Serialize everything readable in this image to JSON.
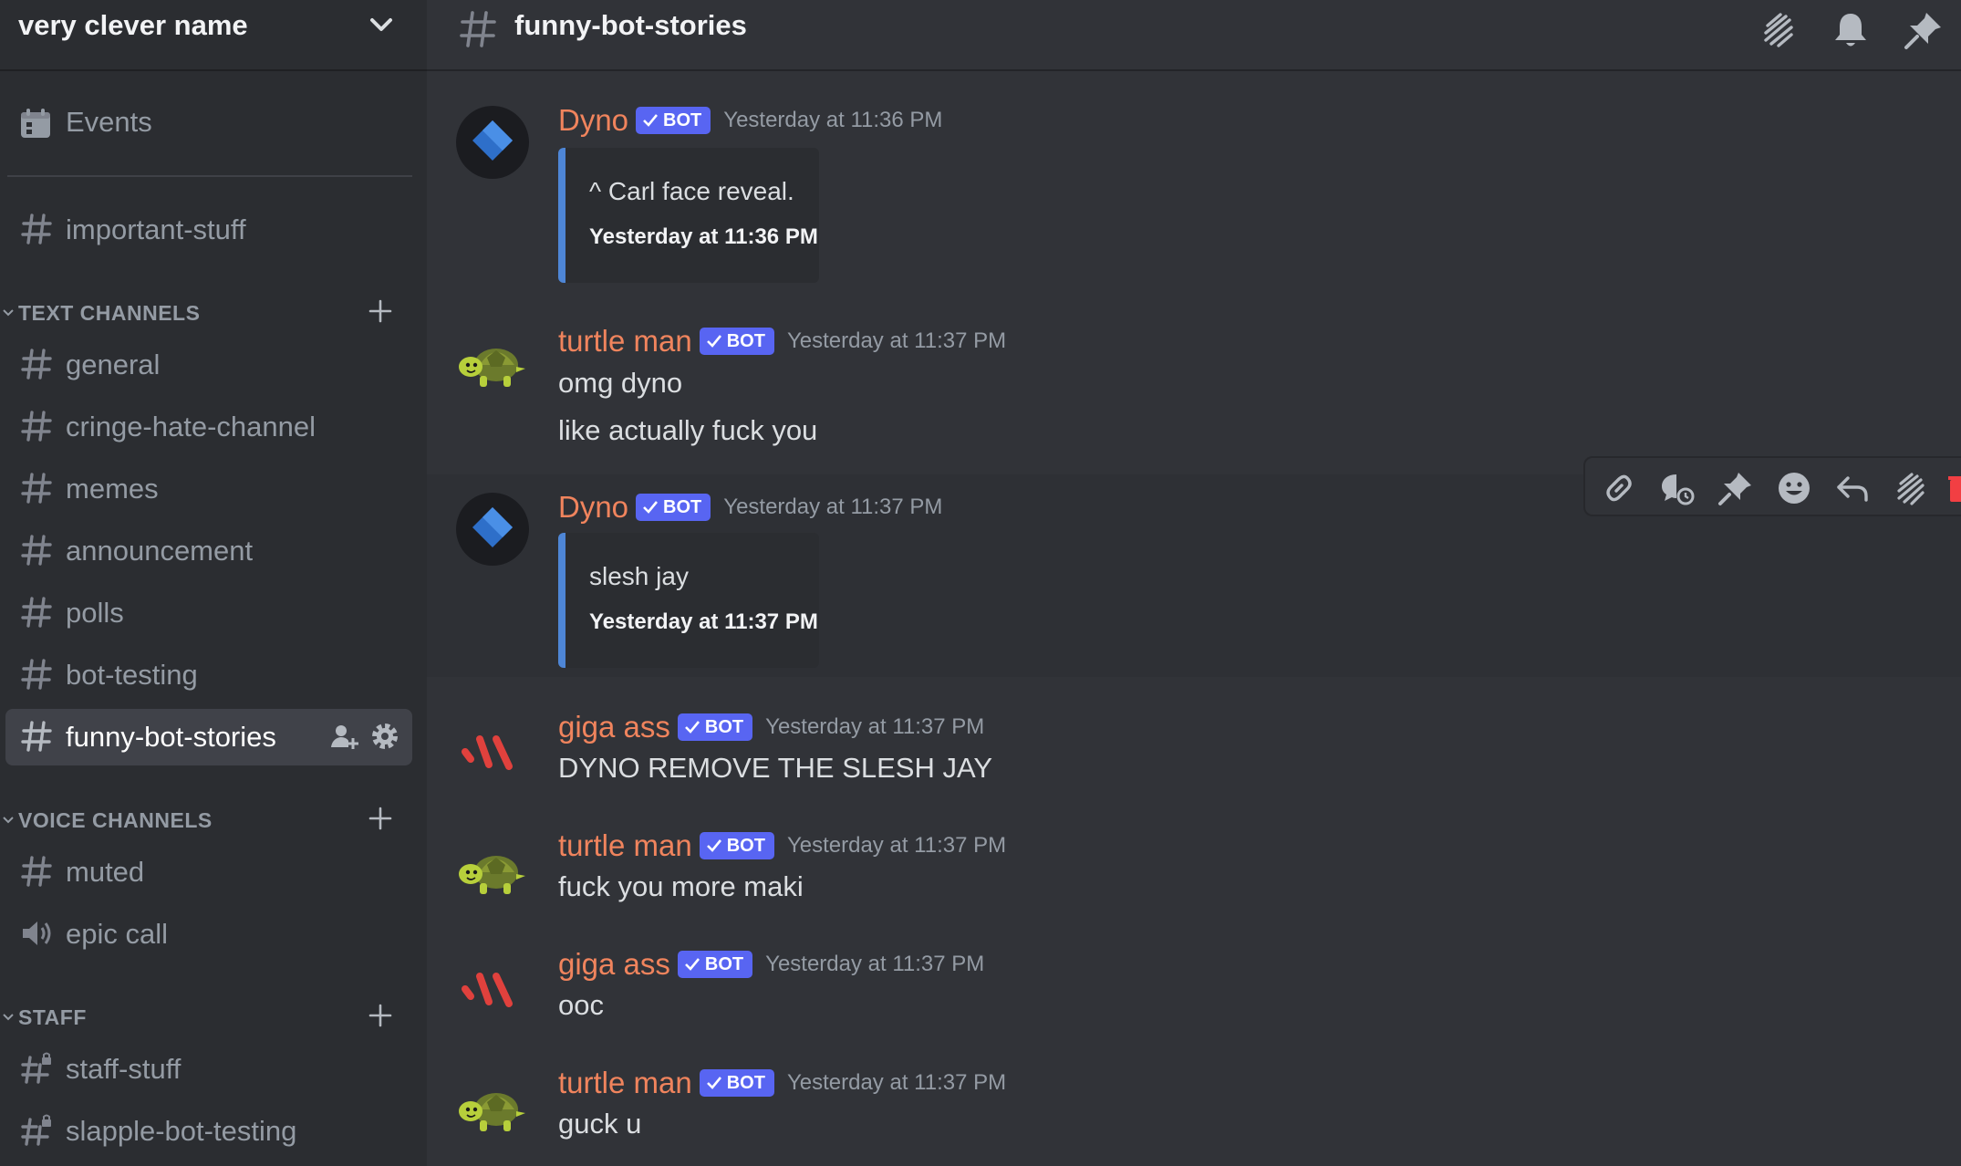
{
  "server": {
    "name": "very clever name"
  },
  "sidebar": {
    "events_label": "Events",
    "top_channels": [
      {
        "label": "important-stuff"
      }
    ],
    "categories": [
      {
        "label": "TEXT CHANNELS"
      },
      {
        "label": "VOICE CHANNELS"
      },
      {
        "label": "STAFF"
      }
    ],
    "text_channels": [
      {
        "label": "general"
      },
      {
        "label": "cringe-hate-channel"
      },
      {
        "label": "memes"
      },
      {
        "label": "announcement"
      },
      {
        "label": "polls"
      },
      {
        "label": "bot-testing"
      },
      {
        "label": "funny-bot-stories",
        "active": true
      }
    ],
    "voice_channels": [
      {
        "label": "muted",
        "icon": "hash-icon"
      },
      {
        "label": "epic call",
        "icon": "speaker-icon"
      }
    ],
    "staff_channels": [
      {
        "label": "staff-stuff",
        "icon": "locked-hash-icon"
      },
      {
        "label": "slapple-bot-testing",
        "icon": "locked-hash-icon"
      }
    ]
  },
  "channel": {
    "title": "funny-bot-stories"
  },
  "badge_label": "BOT",
  "messages": [
    {
      "author": "Dyno",
      "timestamp": "Yesterday at 11:36 PM",
      "avatar": "dyno-avatar",
      "embed": {
        "text": "^ Carl face reveal.",
        "time": "Yesterday at 11:36 PM"
      }
    },
    {
      "author": "turtle man",
      "timestamp": "Yesterday at 11:37 PM",
      "avatar": "turtle-avatar",
      "lines": [
        "omg dyno",
        "like actually fuck you"
      ]
    },
    {
      "author": "Dyno",
      "timestamp": "Yesterday at 11:37 PM",
      "avatar": "dyno-avatar",
      "embed": {
        "text": "slesh jay",
        "time": "Yesterday at 11:37 PM"
      }
    },
    {
      "author": "giga ass",
      "timestamp": "Yesterday at 11:37 PM",
      "avatar": "giga-avatar",
      "lines": [
        "DYNO REMOVE THE SLESH JAY"
      ]
    },
    {
      "author": "turtle man",
      "timestamp": "Yesterday at 11:37 PM",
      "avatar": "turtle-avatar",
      "lines": [
        "fuck you more maki"
      ]
    },
    {
      "author": "giga ass",
      "timestamp": "Yesterday at 11:37 PM",
      "avatar": "giga-avatar",
      "lines": [
        "ooc"
      ]
    },
    {
      "author": "turtle man",
      "timestamp": "Yesterday at 11:37 PM",
      "avatar": "turtle-avatar",
      "lines": [
        "guck u"
      ]
    }
  ],
  "colors": {
    "username": "#f0845d",
    "bot_badge": "#5865f2",
    "embed_border": "#4e86d6",
    "delete_icon": "#f23f43"
  }
}
